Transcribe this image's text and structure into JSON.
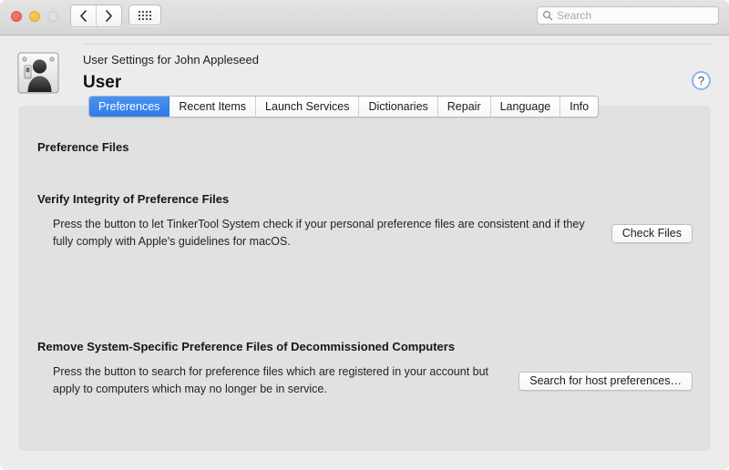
{
  "window": {
    "traffic_lights": [
      "close",
      "minimize",
      "zoom"
    ],
    "nav": {
      "back_label": "Back",
      "forward_label": "Forward"
    },
    "grid_button_label": "Show All"
  },
  "search": {
    "placeholder": "Search",
    "value": ""
  },
  "header": {
    "subtitle": "User Settings for John Appleseed",
    "title": "User",
    "help_label": "?",
    "icon": "user-account-icon"
  },
  "tabs": [
    {
      "label": "Preferences",
      "selected": true
    },
    {
      "label": "Recent Items",
      "selected": false
    },
    {
      "label": "Launch Services",
      "selected": false
    },
    {
      "label": "Dictionaries",
      "selected": false
    },
    {
      "label": "Repair",
      "selected": false
    },
    {
      "label": "Language",
      "selected": false
    },
    {
      "label": "Info",
      "selected": false
    }
  ],
  "main": {
    "section_heading": "Preference Files",
    "groups": [
      {
        "title": "Verify Integrity of Preference Files",
        "description": "Press the button to let TinkerTool System check if your personal preference files are consistent and if they fully comply with Apple's guidelines for macOS.",
        "button_label": "Check Files"
      },
      {
        "title": "Remove System-Specific Preference Files of Decommissioned Computers",
        "description": "Press the button to search for preference files which are registered in your account but apply to computers which may no longer be in service.",
        "button_label": "Search for host preferences…"
      }
    ]
  },
  "colors": {
    "accent": "#2f7ae8",
    "window_bg": "#ececec",
    "panel_bg": "#e1e1e1",
    "titlebar_bg": "#d9d9d9",
    "close": "#e8635a",
    "minimize": "#f0bb3c",
    "zoom_disabled": "#e0e0e0"
  }
}
